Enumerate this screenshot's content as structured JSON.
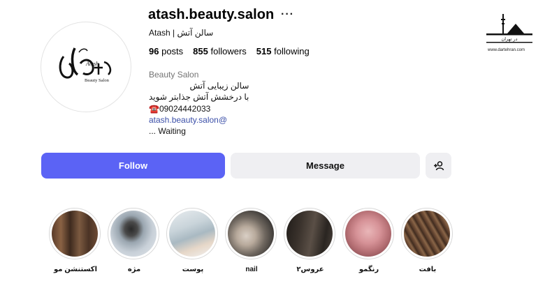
{
  "profile": {
    "username": "atash.beauty.salon",
    "more_label": "···",
    "full_name": "Atash | سالن آتش",
    "stats": {
      "posts_count": "96",
      "posts_label": "posts",
      "followers_count": "855",
      "followers_label": "followers",
      "following_count": "515",
      "following_label": "following"
    },
    "bio": {
      "category": "Beauty Salon",
      "line1": "سالن زیبایی آتش",
      "line2": "با درخشش آتش جذابتر شوید",
      "phone": "☎️09024442033",
      "link": "atash.beauty.salon@",
      "waiting": "... Waiting"
    },
    "logo_text": "آتش",
    "logo_sub": "Beauty Salon",
    "logo_script": "Atash"
  },
  "actions": {
    "follow_label": "Follow",
    "message_label": "Message",
    "add_user_icon": "add-person-icon"
  },
  "highlights": [
    {
      "label": "اکستنشن مو",
      "icon": "hair-extension-photo"
    },
    {
      "label": "مژه",
      "icon": "eyelash-photo"
    },
    {
      "label": "پوست",
      "icon": "skin-care-photo"
    },
    {
      "label": "nail",
      "icon": "nail-photo"
    },
    {
      "label": "عروس۲",
      "icon": "bride-photo"
    },
    {
      "label": "رنگمو",
      "icon": "hair-color-photo"
    },
    {
      "label": "بافت",
      "icon": "braid-photo"
    }
  ],
  "watermark": {
    "text": "در تهران",
    "url": "www.dartehran.com"
  },
  "colors": {
    "follow_bg": "#5b63f5",
    "secondary_bg": "#efeff2",
    "link": "#3b4fa8",
    "muted": "#737373"
  }
}
